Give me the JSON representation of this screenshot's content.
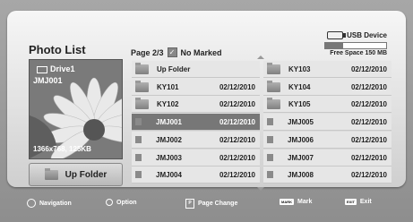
{
  "header": {
    "title": "Photo List",
    "page_info": "Page 2/3",
    "marked_text": "No Marked",
    "check_icon": "checkbox-icon"
  },
  "storage": {
    "device_label": "USB Device",
    "free_space": "Free Space 150 MB"
  },
  "preview": {
    "drive_label": "Drive1",
    "file_name": "JMJ001",
    "resolution_size": "1366x768, 125KB"
  },
  "up_folder_button": {
    "label": "Up Folder"
  },
  "files": {
    "left": [
      {
        "name": "Up Folder",
        "date": "",
        "type": "folder",
        "selected": false
      },
      {
        "name": "KY101",
        "date": "02/12/2010",
        "type": "folder",
        "selected": false
      },
      {
        "name": "KY102",
        "date": "02/12/2010",
        "type": "folder",
        "selected": false
      },
      {
        "name": "JMJ001",
        "date": "02/12/2010",
        "type": "photo",
        "selected": true
      },
      {
        "name": "JMJ002",
        "date": "02/12/2010",
        "type": "photo",
        "selected": false
      },
      {
        "name": "JMJ003",
        "date": "02/12/2010",
        "type": "photo",
        "selected": false
      },
      {
        "name": "JMJ004",
        "date": "02/12/2010",
        "type": "photo",
        "selected": false
      }
    ],
    "right": [
      {
        "name": "KY103",
        "date": "02/12/2010",
        "type": "folder",
        "selected": false
      },
      {
        "name": "KY104",
        "date": "02/12/2010",
        "type": "folder",
        "selected": false
      },
      {
        "name": "KY105",
        "date": "02/12/2010",
        "type": "folder",
        "selected": false
      },
      {
        "name": "JMJ005",
        "date": "02/12/2010",
        "type": "photo",
        "selected": false
      },
      {
        "name": "JMJ006",
        "date": "02/12/2010",
        "type": "photo",
        "selected": false
      },
      {
        "name": "JMJ007",
        "date": "02/12/2010",
        "type": "photo",
        "selected": false
      },
      {
        "name": "JMJ008",
        "date": "02/12/2010",
        "type": "photo",
        "selected": false
      }
    ]
  },
  "footer": {
    "navigation": "Navigation",
    "option": "Option",
    "page_change": "Page Change",
    "mark_key": "MARK",
    "mark": "Mark",
    "exit_key": "EXIT",
    "exit": "Exit"
  }
}
